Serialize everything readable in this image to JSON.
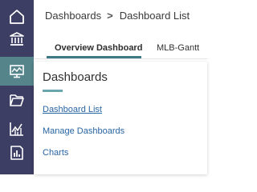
{
  "sidebar": {
    "items": [
      {
        "icon": "home-icon"
      },
      {
        "icon": "institution-icon"
      },
      {
        "icon": "dashboard-monitor-icon",
        "active": true
      },
      {
        "icon": "folder-icon"
      },
      {
        "icon": "line-chart-icon"
      },
      {
        "icon": "report-icon"
      }
    ],
    "bg_color": "#3d3e63",
    "active_color": "#55848a"
  },
  "breadcrumb": {
    "root": "Dashboards",
    "separator": ">",
    "current": "Dashboard List"
  },
  "tabs": [
    {
      "label": "Overview Dashboard",
      "active": true
    },
    {
      "label": "MLB-Gantt",
      "active": false
    }
  ],
  "flyout": {
    "title": "Dashboards",
    "links": [
      {
        "label": "Dashboard List",
        "underlined": true
      },
      {
        "label": "Manage Dashboards"
      },
      {
        "label": "Charts"
      }
    ],
    "link_color": "#2764a3",
    "accent_color": "#69a6ae"
  }
}
